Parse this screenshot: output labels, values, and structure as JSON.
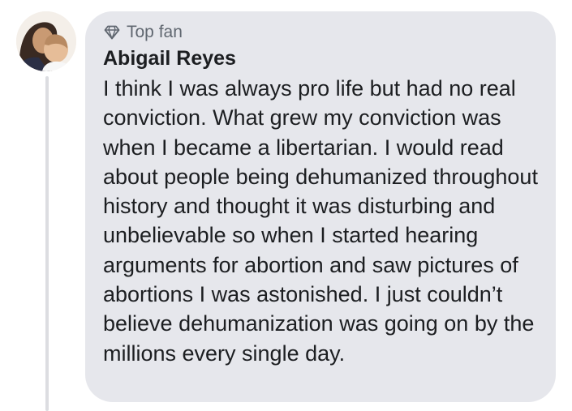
{
  "comment": {
    "badge": {
      "icon": "diamond-icon",
      "label": "Top fan"
    },
    "author": "Abigail Reyes",
    "avatar": {
      "icon": "profile-photo-avatar"
    },
    "text": "I think I was always pro life but had no real conviction. What grew my conviction was when I became a libertarian. I would read about people being dehumanized throughout history and thought it was disturbing and unbelievable so when I started hearing arguments for abortion and saw pictures of abortions I was astonished. I just couldn’t believe dehumanization was going on by the millions every single day."
  },
  "colors": {
    "bubble_background": "#e6e7ec",
    "text": "#1c1e21",
    "secondary_text": "#606770",
    "thread_line": "#dcdde1"
  }
}
